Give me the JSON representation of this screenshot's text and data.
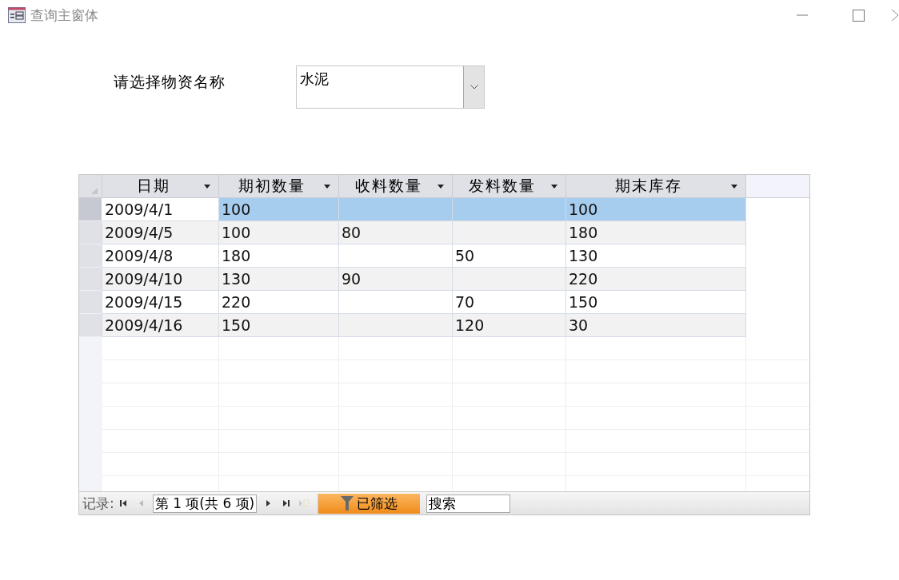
{
  "window": {
    "title": "查询主窗体"
  },
  "filter_form": {
    "label": "请选择物资名称",
    "combo_value": "水泥"
  },
  "table": {
    "columns": [
      "日期",
      "期初数量",
      "收料数量",
      "发料数量",
      "期末库存"
    ],
    "rows": [
      {
        "cells": [
          "2009/4/1",
          "100",
          "",
          "",
          "100"
        ],
        "selected": true
      },
      {
        "cells": [
          "2009/4/5",
          "100",
          "80",
          "",
          "180"
        ],
        "selected": false
      },
      {
        "cells": [
          "2009/4/8",
          "180",
          "",
          "50",
          "130"
        ],
        "selected": false
      },
      {
        "cells": [
          "2009/4/10",
          "130",
          "90",
          "",
          "220"
        ],
        "selected": false
      },
      {
        "cells": [
          "2009/4/15",
          "220",
          "",
          "70",
          "150"
        ],
        "selected": false
      },
      {
        "cells": [
          "2009/4/16",
          "150",
          "",
          "120",
          "30"
        ],
        "selected": false
      }
    ]
  },
  "navigation": {
    "label": "记录:",
    "position": "第 1 项(共 6 项)",
    "filter_status": "已筛选",
    "search_placeholder": "搜索"
  }
}
